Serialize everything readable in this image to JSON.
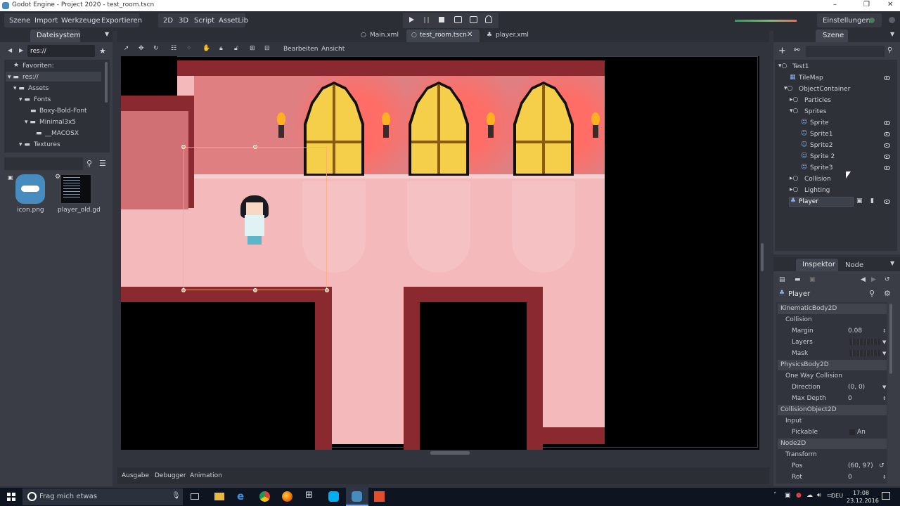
{
  "window": {
    "title": "Godot Engine - Project 2020 - test_room.tscn",
    "min": "–",
    "max": "❐",
    "close": "✕"
  },
  "menu": {
    "items": [
      "Szene",
      "Import",
      "Werkzeuge",
      "Exportieren"
    ]
  },
  "modes": [
    "2D",
    "3D",
    "Script",
    "AssetLib"
  ],
  "settings_label": "Einstellungen",
  "tabs": {
    "filesystem": "Dateisystem",
    "scene": "Szene",
    "inspector": "Inspektor",
    "node": "Node"
  },
  "scene_tabs": [
    "Main.xml",
    "test_room.tscn",
    "player.xml"
  ],
  "filesystem": {
    "path": "res://",
    "favorites": "Favoriten:",
    "tree": [
      "res://",
      "Assets",
      "Fonts",
      "Boxy-Bold-Font",
      "Minimal3x5",
      "__MACOSX",
      "Textures"
    ],
    "files": [
      "icon.png",
      "player_old.gd"
    ]
  },
  "viewport_toolbar": {
    "edit": "Bearbeiten",
    "view": "Ansicht"
  },
  "scene_tree": {
    "items": [
      "Test1",
      "TileMap",
      "ObjectContainer",
      "Particles",
      "Sprites",
      "Sprite",
      "Sprite1",
      "Sprite2",
      "Sprite 2",
      "Sprite3",
      "Collision",
      "Lighting",
      "Player"
    ]
  },
  "inspector": {
    "node_name": "Player",
    "sections": [
      "KinematicBody2D",
      "PhysicsBody2D",
      "CollisionObject2D",
      "Node2D"
    ],
    "groups": [
      "Collision",
      "One Way Collision",
      "Input",
      "Transform"
    ],
    "props": {
      "margin": {
        "label": "Margin",
        "value": "0.08"
      },
      "layers": {
        "label": "Layers"
      },
      "mask": {
        "label": "Mask"
      },
      "direction": {
        "label": "Direction",
        "value": "(0, 0)"
      },
      "max_depth": {
        "label": "Max Depth",
        "value": "0"
      },
      "pickable": {
        "label": "Pickable",
        "value": "An"
      },
      "pos": {
        "label": "Pos",
        "value": "(60, 97)"
      },
      "rot": {
        "label": "Rot",
        "value": "0"
      }
    }
  },
  "bottom_tabs": [
    "Ausgabe",
    "Debugger",
    "Animation"
  ],
  "taskbar": {
    "search": "Frag mich etwas",
    "lang": "DEU",
    "time": "17:08",
    "date": "23.12.2016"
  },
  "colors": {
    "accent": "#5d8ad8",
    "bg": "#31343c",
    "wall": "#8a2a30",
    "floor": "#f4b9bb"
  }
}
